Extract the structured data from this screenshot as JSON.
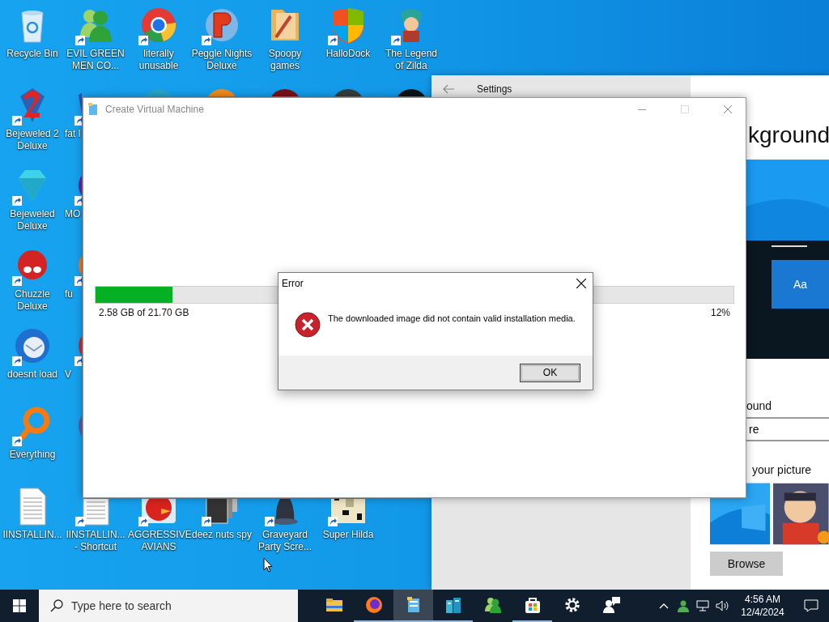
{
  "desktop_icons": [
    {
      "label": "Recycle Bin",
      "shortcut": false,
      "kind": "full"
    },
    {
      "label": "EVIL GREEN MEN CO...",
      "shortcut": true,
      "kind": "full"
    },
    {
      "label": "literally unusable",
      "shortcut": true,
      "kind": "full"
    },
    {
      "label": "Peggle Nights Deluxe",
      "shortcut": true,
      "kind": "full"
    },
    {
      "label": "Spoopy games",
      "shortcut": false,
      "kind": "full"
    },
    {
      "label": "HalloDock",
      "shortcut": true,
      "kind": "full"
    },
    {
      "label": "The Legend of Zilda",
      "shortcut": true,
      "kind": "full"
    },
    {
      "label": "Bejeweled 2 Deluxe",
      "shortcut": true,
      "kind": "full"
    },
    {
      "label": "fat l",
      "shortcut": true,
      "kind": "partial"
    },
    {
      "label": "Bejeweled Deluxe",
      "shortcut": true,
      "kind": "full"
    },
    {
      "label": "MO",
      "shortcut": true,
      "kind": "partial"
    },
    {
      "label": "Chuzzle Deluxe",
      "shortcut": true,
      "kind": "full"
    },
    {
      "label": "fu",
      "shortcut": true,
      "kind": "partial"
    },
    {
      "label": "doesnt load",
      "shortcut": true,
      "kind": "full"
    },
    {
      "label": "V",
      "shortcut": true,
      "kind": "partial"
    },
    {
      "label": "Everything",
      "shortcut": true,
      "kind": "full"
    },
    {
      "label": "IINSTALLIN...",
      "shortcut": false,
      "kind": "full"
    },
    {
      "label": "IINSTALLIN... - Shortcut",
      "shortcut": true,
      "kind": "full"
    },
    {
      "label": "AGGRESSIVE AVIANS",
      "shortcut": true,
      "kind": "full"
    },
    {
      "label": "deez nuts spy",
      "shortcut": true,
      "kind": "full"
    },
    {
      "label": "Graveyard Party Scre...",
      "shortcut": true,
      "kind": "full"
    },
    {
      "label": "Super Hilda",
      "shortcut": true,
      "kind": "full"
    }
  ],
  "settings_window": {
    "title": "Settings",
    "heading": "kground",
    "preview_text": "Aa",
    "label_1": "ound",
    "dropdown_value": "re",
    "label_2": "your picture",
    "browse_button": "Browse"
  },
  "vm_window": {
    "title": "Create Virtual Machine",
    "progress": {
      "level": 0.12,
      "size_text": "2.58 GB of 21.70 GB",
      "percent_text": "12%"
    }
  },
  "error_dialog": {
    "title": "Error",
    "message": "The downloaded image did not contain valid installation media.",
    "ok_button": "OK"
  },
  "taskbar": {
    "search": {
      "placeholder": "Type here to search"
    },
    "apps": [
      {
        "running": false,
        "selected": false
      },
      {
        "running": true,
        "selected": false
      },
      {
        "running": true,
        "selected": true
      },
      {
        "running": true,
        "selected": false
      },
      {
        "running": false,
        "selected": false
      },
      {
        "running": true,
        "selected": false
      },
      {
        "running": false,
        "selected": false
      },
      {
        "running": false,
        "selected": false
      }
    ],
    "clock": {
      "time": "4:56 AM",
      "date": "12/4/2024"
    }
  }
}
